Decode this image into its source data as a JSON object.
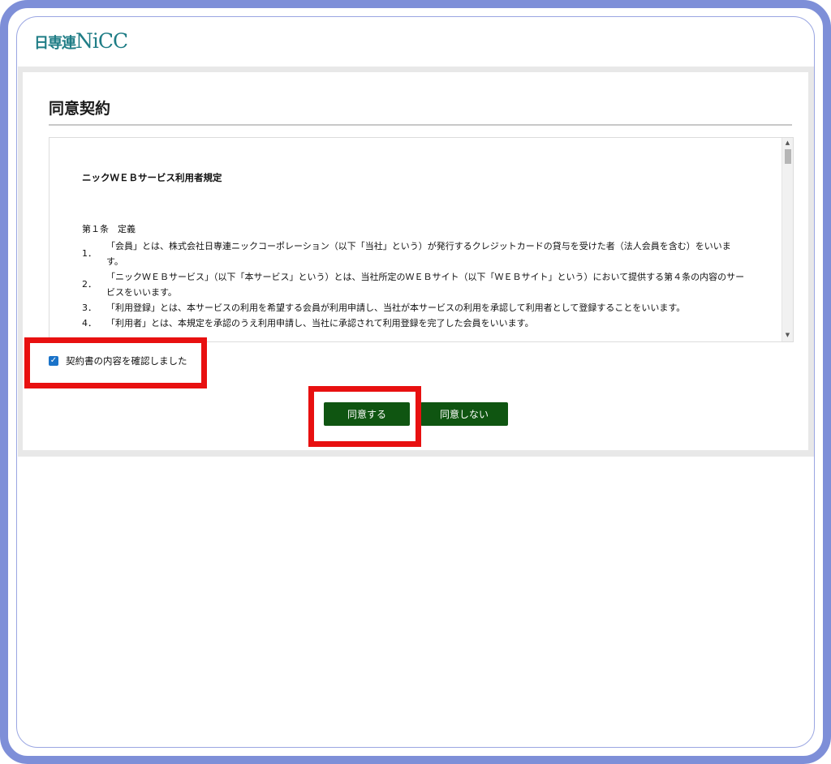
{
  "logo": {
    "jp": "日専連",
    "en": "NiCC"
  },
  "page": {
    "title": "同意契約"
  },
  "terms": {
    "heading": "ニックＷＥＢサービス利用者規定",
    "article_title": "第１条　定義",
    "clauses": [
      {
        "num": "1．",
        "text": "「会員」とは、株式会社日専連ニックコーポレーション（以下「当社」という）が発行するクレジットカードの貸与を受けた者（法人会員を含む）をいいます。"
      },
      {
        "num": "2．",
        "text": "「ニックＷＥＢサービス」（以下「本サービス」という）とは、当社所定のＷＥＢサイト（以下「ＷＥＢサイト」という）において提供する第４条の内容のサービスをいいます。"
      },
      {
        "num": "3．",
        "text": "「利用登録」とは、本サービスの利用を希望する会員が利用申請し、当社が本サービスの利用を承認して利用者として登録することをいいます。"
      },
      {
        "num": "4．",
        "text": "「利用者」とは、本規定を承認のうえ利用申請し、当社に承認されて利用登録を完了した会員をいいます。"
      }
    ]
  },
  "confirm": {
    "label": "契約書の内容を確認しました",
    "checked": true
  },
  "buttons": {
    "agree": "同意する",
    "disagree": "同意しない"
  },
  "colors": {
    "frame": "#7e8fd8",
    "button": "#0f5511",
    "highlight": "#e81010",
    "logo": "#1f7d86",
    "checkbox": "#1a73c9"
  }
}
